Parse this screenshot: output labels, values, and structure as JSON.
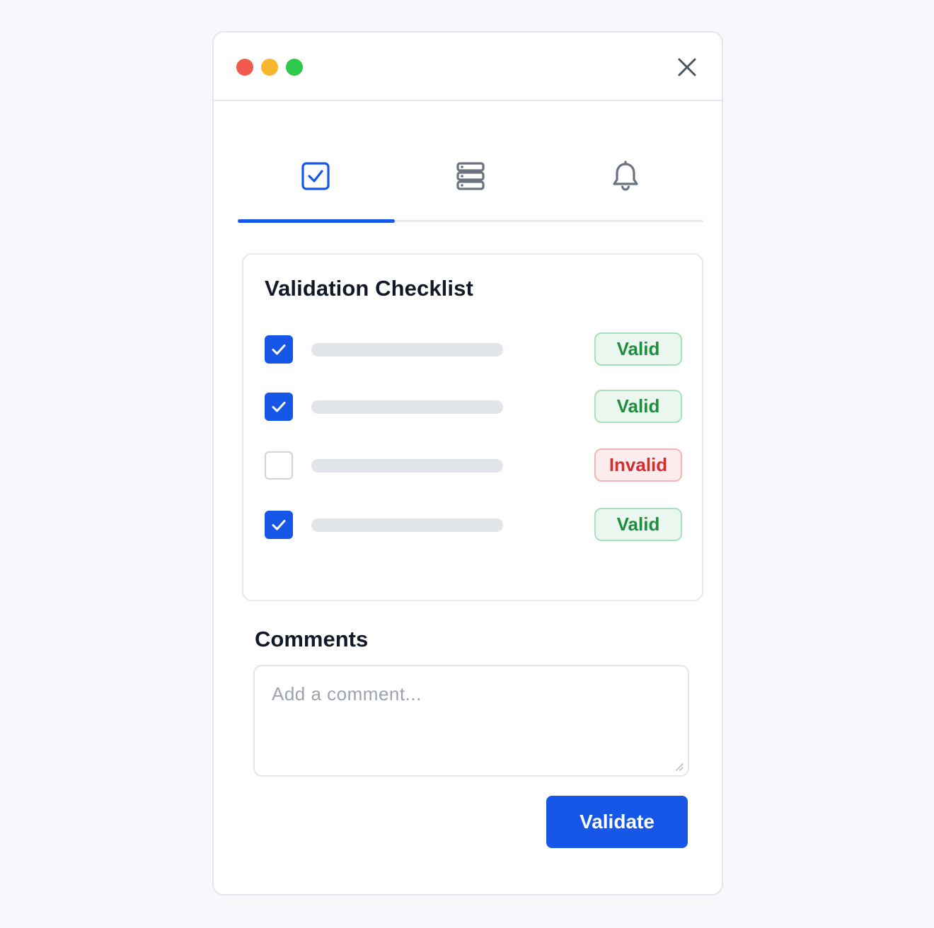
{
  "colors": {
    "accent": "#1657e8",
    "dot_red": "#f05a4f",
    "dot_yellow": "#f8b62e",
    "dot_green": "#2ec84a",
    "valid_text": "#1e8e3e",
    "invalid_text": "#d32f2f",
    "tab_inactive": "#6b7280"
  },
  "window": {
    "controls": [
      "close-dot",
      "minimize-dot",
      "maximize-dot"
    ],
    "close_icon": "close-icon"
  },
  "tabs": [
    {
      "icon": "checkbox-check-icon",
      "active": true
    },
    {
      "icon": "server-stack-icon",
      "active": false
    },
    {
      "icon": "bell-icon",
      "active": false
    }
  ],
  "checklist": {
    "title": "Validation Checklist",
    "items": [
      {
        "checked": true,
        "status": "Valid"
      },
      {
        "checked": true,
        "status": "Valid"
      },
      {
        "checked": false,
        "status": "Invalid"
      },
      {
        "checked": true,
        "status": "Valid"
      }
    ]
  },
  "comments": {
    "title": "Comments",
    "placeholder": "Add a comment...",
    "value": ""
  },
  "actions": {
    "validate_label": "Validate"
  }
}
